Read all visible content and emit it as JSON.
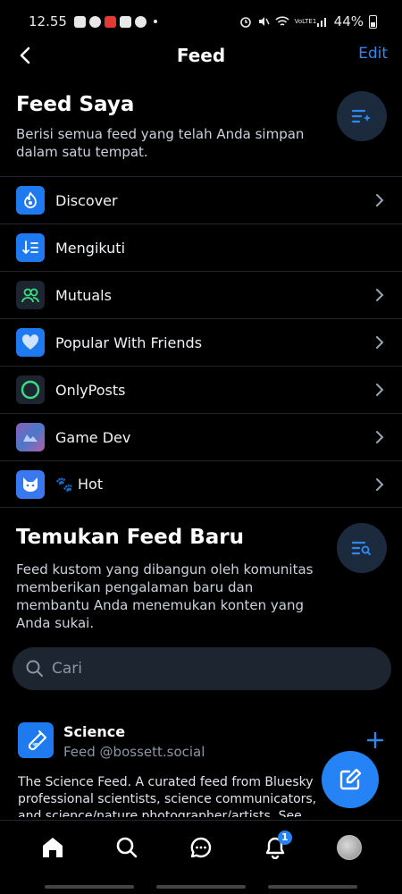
{
  "status_bar": {
    "time": "12.55",
    "battery": "44%",
    "network": "VoLTE1"
  },
  "header": {
    "title": "Feed",
    "edit_label": "Edit"
  },
  "my_feeds": {
    "title": "Feed Saya",
    "description_line1": "Berisi semua feed yang telah Anda simpan",
    "description_line2": "dalam satu tempat.",
    "items": [
      {
        "label": "Discover",
        "icon": "discover-icon",
        "color": "#1f7af0",
        "chevron": true
      },
      {
        "label": "Mengikuti",
        "icon": "following-icon",
        "color": "#1f7af0",
        "chevron": false
      },
      {
        "label": "Mutuals",
        "icon": "mutuals-icon",
        "color": "#1c2530",
        "chevron": true
      },
      {
        "label": "Popular With Friends",
        "icon": "heart-icon",
        "color": "#1f7af0",
        "chevron": true
      },
      {
        "label": "OnlyPosts",
        "icon": "circle-icon",
        "color": "#1c2530",
        "chevron": true
      },
      {
        "label": "Game Dev",
        "icon": "game-dev-icon",
        "color": "#6a4c93",
        "chevron": true
      },
      {
        "label": "🐾 Hot",
        "icon": "cat-icon",
        "color": "#3a78f0",
        "chevron": true
      }
    ]
  },
  "discover": {
    "title": "Temukan Feed Baru",
    "description_lines": [
      "Feed kustom yang dibangun oleh komunitas",
      "memberikan pengalaman baru dan",
      "membantu Anda menemukan konten yang",
      "Anda sukai."
    ],
    "search_placeholder": "Cari"
  },
  "feed_card": {
    "title": "Science",
    "subtitle": "Feed @bossett.social",
    "description": "The Science Feed. A curated feed from Bluesky professional scientists,  science communicators, and science/nature photographer/artists. See https://b"
  },
  "bottom_nav": {
    "notification_count": "1"
  },
  "colors": {
    "accent": "#2f87f0",
    "background": "#000000"
  }
}
